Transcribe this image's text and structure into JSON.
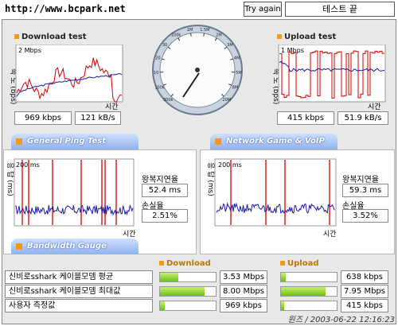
{
  "url": "http://www.bcpark.net",
  "try_again": "Try again",
  "status": "테스트 끝",
  "download": {
    "title": "Download test",
    "yaxis": "속 도 (bps)",
    "scale": "2 Mbps",
    "xaxis": "시간",
    "kbps": "969 kbps",
    "kBs": "121 kB/s"
  },
  "upload": {
    "title": "Upload test",
    "yaxis": "속 도 (bps)",
    "scale": "1 Mbps",
    "xaxis": "시간",
    "kbps": "415 kbps",
    "kBs": "51.9 kB/s"
  },
  "gauge": {
    "ticks": [
      "300k",
      "100k",
      "10",
      "20",
      "30",
      "100k",
      "1M",
      "1.5M",
      "2M",
      "3M",
      "4M",
      "5M",
      "8M",
      "20M"
    ],
    "needle_value_mbps": 0.969
  },
  "tabs": {
    "ping": "General Ping Test",
    "game": "Network Game & VoIP Test",
    "bandwidth": "Bandwidth Gauge"
  },
  "ping_left": {
    "yaxis": "응 답 (ms)",
    "scale": "200 ms",
    "xaxis": "시간",
    "rtt_label": "왕복지연율",
    "rtt": "52.4 ms",
    "loss_label": "손실율",
    "loss": "2.51%"
  },
  "ping_right": {
    "yaxis": "응 답 (ms)",
    "scale": "200 ms",
    "xaxis": "시간",
    "rtt_label": "왕복지연율",
    "rtt": "59.3 ms",
    "loss_label": "손실율",
    "loss": "3.52%"
  },
  "gauge_table": {
    "download_header": "Download",
    "upload_header": "Upload",
    "rows": [
      {
        "label": "신비로sshark 케이블모뎀 평균",
        "down": "3.53 Mbps",
        "down_frac": 0.33,
        "up": "638 kbps",
        "up_frac": 0.08
      },
      {
        "label": "신비로sshark 케이블모뎀 최대값",
        "down": "8.00 Mbps",
        "down_frac": 0.8,
        "up": "7.95 Mbps",
        "up_frac": 0.8
      },
      {
        "label": "사용자 측정값",
        "down": "969 kbps",
        "down_frac": 0.09,
        "up": "415 kbps",
        "up_frac": 0.05
      }
    ]
  },
  "footer": "원즈 / 2003-06-22 12:16:23",
  "colors": {
    "red_line": "#cc0000",
    "blue_line": "#1a1aa6",
    "tab": "#8fb2ec",
    "bullet": "#f39a1e",
    "bar": "#7ccc22"
  }
}
